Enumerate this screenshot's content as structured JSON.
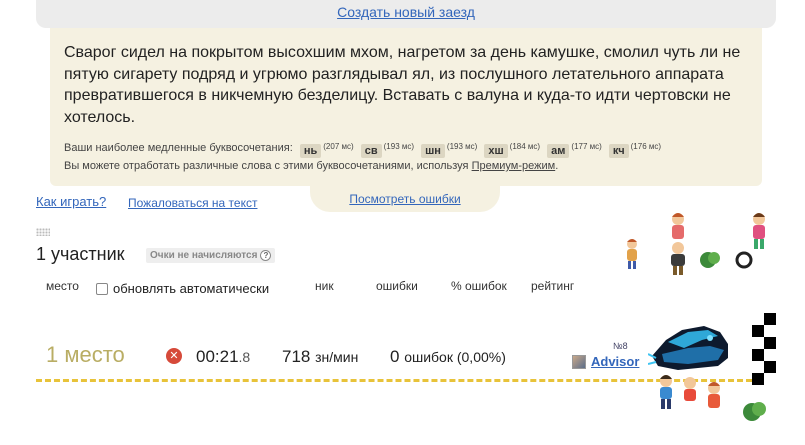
{
  "top": {
    "new_race_link": "Создать новый заезд"
  },
  "race_text": "Сварог сидел на покрытом высохшим мхом, нагретом за день камушке, смолил чуть ли не пятую сигарету подряд и угрюмо разглядывал ял, из послушного летательного аппарата превратившегося в никчемную безделицу. Вставать с валуна и куда-то идти чертовски не хотелось.",
  "slow_combos": {
    "label": "Ваши наиболее медленные буквосочетания:",
    "items": [
      {
        "combo": "нь",
        "ms": "(207 мс)"
      },
      {
        "combo": "св",
        "ms": "(193 мс)"
      },
      {
        "combo": "шн",
        "ms": "(193 мс)"
      },
      {
        "combo": "хш",
        "ms": "(184 мс)"
      },
      {
        "combo": "ам",
        "ms": "(177 мс)"
      },
      {
        "combo": "кч",
        "ms": "(176 мс)"
      }
    ],
    "practice_text": "Вы можете отработать различные слова с этими буквосочетаниями, используя",
    "practice_link": "Премиум-режим",
    "practice_end": "."
  },
  "links": {
    "how_to_play": "Как играть?",
    "complain": "Пожаловаться на текст",
    "view_errors": "Посмотреть ошибки"
  },
  "race": {
    "participants": "1 участник",
    "no_points": "Очки не начисляются",
    "help_glyph": "?"
  },
  "table_headers": {
    "place": "место",
    "auto_update": "обновлять автоматически",
    "nick": "ник",
    "errors": "ошибки",
    "error_percent": "% ошибок",
    "rating": "рейтинг"
  },
  "result": {
    "place": "1 место",
    "status_glyph": "✕",
    "time_main": "00:21",
    "time_sub": ".8",
    "speed": "718",
    "speed_unit": "зн/мин",
    "errors_count": "0",
    "errors_text": "ошибок (0,00%)",
    "rank": "№8",
    "nick": "Advisor"
  },
  "colors": {
    "link": "#3366bb",
    "panel_bg": "#f5f1e1",
    "place_text": "#b9ad64",
    "track": "#e8c33a",
    "error_icon": "#d64a3a"
  }
}
